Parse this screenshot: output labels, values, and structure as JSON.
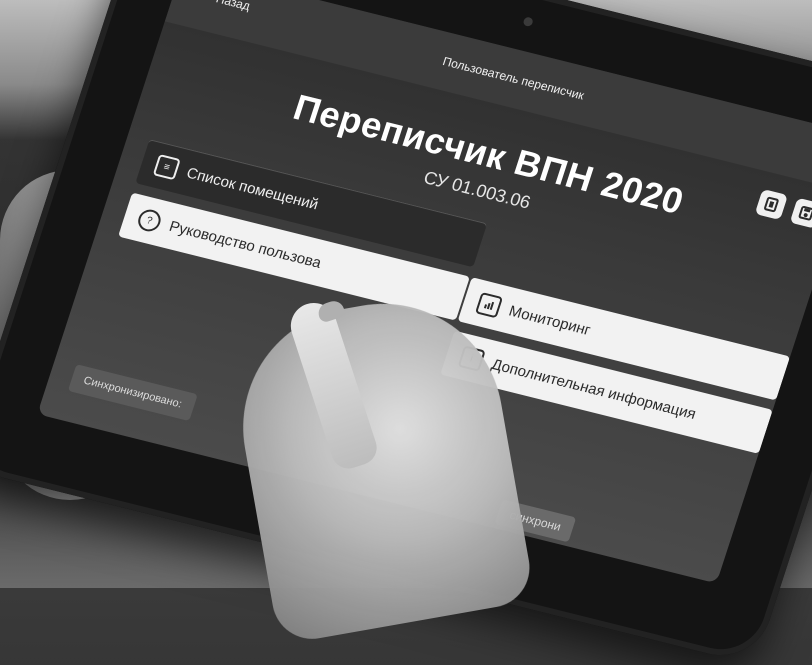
{
  "app": {
    "back_label": "Назад",
    "header_subtitle": "Пользователь переписчик",
    "title": "Переписчик ВПН 2020",
    "code": "СУ 01.003.06"
  },
  "menu": {
    "items": [
      {
        "label": "Список помещений",
        "icon": "list-icon",
        "style": "dark"
      },
      {
        "label": "Руководство пользова",
        "icon": "info-circle-icon",
        "style": "light"
      },
      {
        "label": "Мониторинг",
        "icon": "chart-icon",
        "style": "light"
      },
      {
        "label": "Дополнительная информация",
        "icon": "info-square-icon",
        "style": "light"
      }
    ]
  },
  "status": {
    "synced_label": "Синхронизировано",
    "sync_partial": "синхрони"
  },
  "colors": {
    "tile_dark": "#2b2b2b",
    "tile_light": "#f2f2f2",
    "screen_bg": "#3a3a3a"
  }
}
